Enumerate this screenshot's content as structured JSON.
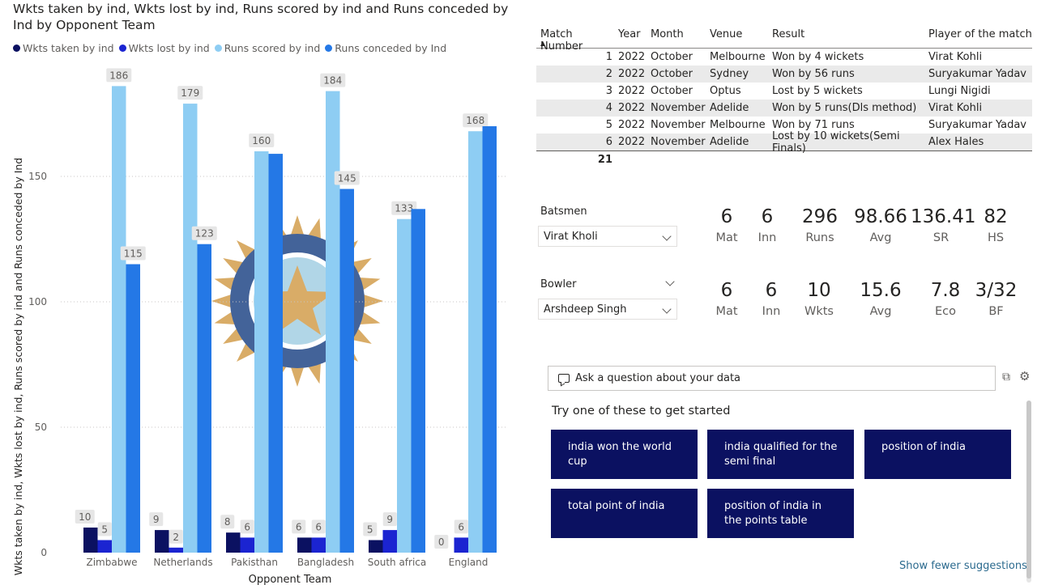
{
  "chart": {
    "title": "Wkts taken by ind, Wkts lost by ind, Runs scored by ind and Runs conceded by Ind by Opponent Team",
    "legend": [
      "Wkts taken by ind",
      "Wkts lost by ind",
      "Runs scored by ind",
      "Runs conceded by Ind"
    ],
    "colors": [
      "#0b1161",
      "#1b24d1",
      "#8ecdf3",
      "#2478e6"
    ]
  },
  "chart_data": {
    "type": "bar",
    "title": "Wkts taken by ind, Wkts lost by ind, Runs scored by ind and Runs conceded by Ind by Opponent Team",
    "xlabel": "Opponent Team",
    "ylabel": "Wkts taken by ind, Wkts lost by ind, Runs scored by ind and Runs conceded by Ind",
    "categories": [
      "Zimbabwe",
      "Netherlands",
      "Pakisthan",
      "Bangladesh",
      "South africa",
      "England"
    ],
    "series": [
      {
        "name": "Wkts taken by ind",
        "values": [
          10,
          9,
          8,
          6,
          5,
          0
        ],
        "labels": [
          "10",
          "9",
          "8",
          "6",
          "5",
          "0"
        ]
      },
      {
        "name": "Wkts lost by ind",
        "values": [
          5,
          2,
          6,
          6,
          9,
          6
        ],
        "labels": [
          "5",
          "2",
          "6",
          "6",
          "9",
          "6"
        ]
      },
      {
        "name": "Runs scored by ind",
        "values": [
          186,
          179,
          160,
          184,
          133,
          168
        ],
        "labels": [
          "186",
          "179",
          "160",
          "184",
          "133",
          "168"
        ]
      },
      {
        "name": "Runs conceded by Ind",
        "values": [
          115,
          123,
          159,
          145,
          137,
          170
        ],
        "labels": [
          "115",
          "123",
          "",
          "145",
          "",
          ""
        ]
      }
    ],
    "ylim": [
      0,
      190
    ],
    "yticks": [
      0,
      50,
      100,
      150
    ],
    "grid": true,
    "legend_position": "top-left"
  },
  "table": {
    "headers": [
      "Match Number",
      "Year",
      "Month",
      "Venue",
      "Result",
      "Player of the match"
    ],
    "rows": [
      [
        "1",
        "2022",
        "October",
        "Melbourne",
        "Won by 4 wickets",
        "Virat Kohli"
      ],
      [
        "2",
        "2022",
        "October",
        "Sydney",
        "Won by 56 runs",
        "Suryakumar Yadav"
      ],
      [
        "3",
        "2022",
        "October",
        "Optus",
        "Lost by 5 wickets",
        "Lungi Nigidi"
      ],
      [
        "4",
        "2022",
        "November",
        "Adelide",
        "Won by 5 runs(Dls method)",
        "Virat Kohli"
      ],
      [
        "5",
        "2022",
        "November",
        "Melbourne",
        "Won by 71 runs",
        "Suryakumar Yadav"
      ],
      [
        "6",
        "2022",
        "November",
        "Adelide",
        "Lost by 10 wickets(Semi Finals)",
        "Alex Hales"
      ]
    ],
    "total": "21"
  },
  "batsmen": {
    "label": "Batsmen",
    "selected": "Virat Kholi",
    "stats": [
      {
        "value": "6",
        "label": "Mat"
      },
      {
        "value": "6",
        "label": "Inn"
      },
      {
        "value": "296",
        "label": "Runs"
      },
      {
        "value": "98.66",
        "label": "Avg"
      },
      {
        "value": "136.41",
        "label": "SR"
      },
      {
        "value": "82",
        "label": "HS"
      }
    ]
  },
  "bowler": {
    "label": "Bowler",
    "selected": "Arshdeep Singh",
    "stats": [
      {
        "value": "6",
        "label": "Mat"
      },
      {
        "value": "6",
        "label": "Inn"
      },
      {
        "value": "10",
        "label": "Wkts"
      },
      {
        "value": "15.6",
        "label": "Avg"
      },
      {
        "value": "7.8",
        "label": "Eco"
      },
      {
        "value": "3/32",
        "label": "BF"
      }
    ]
  },
  "qa": {
    "placeholder": "Ask a question about your data",
    "try_text": "Try one of these to get started",
    "suggestions": [
      "india won the world cup",
      "india qualified for the semi final",
      "position of india",
      "total point of india",
      "position of india in the points table"
    ],
    "show_fewer": "Show fewer suggestions"
  }
}
